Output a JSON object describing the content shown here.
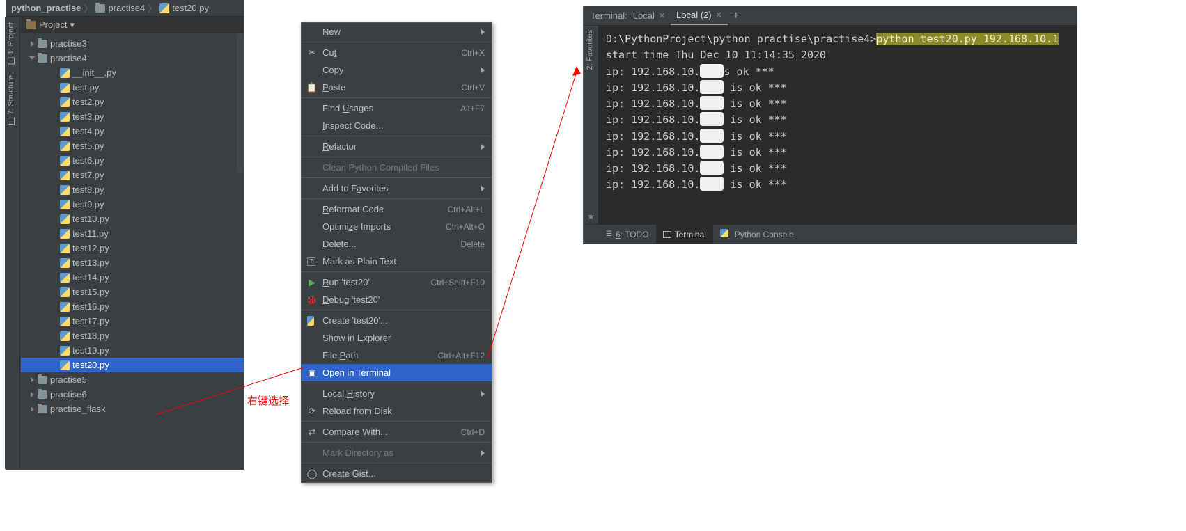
{
  "breadcrumb": {
    "root": "python_practise",
    "folder": "practise4",
    "file": "test20.py"
  },
  "sidebar_tabs": {
    "project": "1: Project",
    "structure": "7: Structure"
  },
  "project_header": {
    "label": "Project"
  },
  "tree": {
    "practise3": "practise3",
    "practise4": "practise4",
    "files": [
      "__init__.py",
      "test.py",
      "test2.py",
      "test3.py",
      "test4.py",
      "test5.py",
      "test6.py",
      "test7.py",
      "test8.py",
      "test9.py",
      "test10.py",
      "test11.py",
      "test12.py",
      "test13.py",
      "test14.py",
      "test15.py",
      "test16.py",
      "test17.py",
      "test18.py",
      "test19.py",
      "test20.py"
    ],
    "practise5": "practise5",
    "practise6": "practise6",
    "practise_flask": "practise_flask"
  },
  "context_menu": {
    "new": "New",
    "cut": "Cut",
    "cut_k": "Ctrl+X",
    "copy": "Copy",
    "paste": "Paste",
    "paste_k": "Ctrl+V",
    "find_usages": "Find Usages",
    "find_usages_k": "Alt+F7",
    "inspect": "Inspect Code...",
    "refactor": "Refactor",
    "clean_py": "Clean Python Compiled Files",
    "add_fav": "Add to Favorites",
    "reformat": "Reformat Code",
    "reformat_k": "Ctrl+Alt+L",
    "optimize": "Optimize Imports",
    "optimize_k": "Ctrl+Alt+O",
    "delete": "Delete...",
    "delete_k": "Delete",
    "mark_plain": "Mark as Plain Text",
    "run": "Run 'test20'",
    "run_k": "Ctrl+Shift+F10",
    "debug": "Debug 'test20'",
    "create": "Create 'test20'...",
    "show_explorer": "Show in Explorer",
    "file_path": "File Path",
    "file_path_k": "Ctrl+Alt+F12",
    "open_terminal": "Open in Terminal",
    "local_history": "Local History",
    "reload": "Reload from Disk",
    "compare": "Compare With...",
    "compare_k": "Ctrl+D",
    "mark_dir": "Mark Directory as",
    "gist": "Create Gist..."
  },
  "annotation": "右键选择",
  "terminal": {
    "header_label": "Terminal:",
    "tabs": {
      "t1": "Local",
      "t2": "Local (2)"
    },
    "side_tab": "2: Favorites",
    "prompt_path": "D:\\PythonProject\\python_practise\\practise4>",
    "command": "python test20.py 192.168.10.1",
    "start_line": "start time Thu Dec 10 11:14:35 2020",
    "ip_lines_prefix": "ip: 192.168.10.",
    "ip_ok_a": "s ok ***",
    "ip_ok_b": " is ok ***",
    "ip_ok_c": "is ok ***",
    "bottom_tabs": {
      "todo": "6: TODO",
      "terminal": "Terminal",
      "python_console": "Python Console"
    }
  }
}
